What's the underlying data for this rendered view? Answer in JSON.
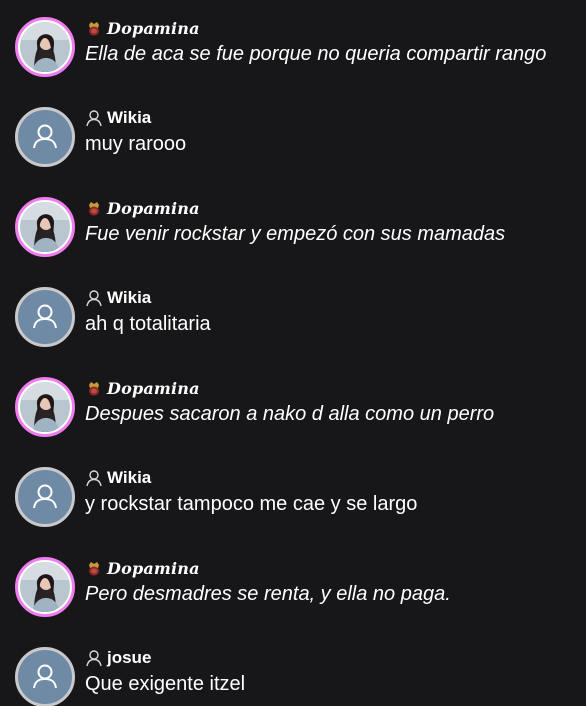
{
  "messages": [
    {
      "author": "Dopamina",
      "text": "Ella de aca se fue porque no queria compartir rango",
      "avatar": "photo-avatar",
      "role_icon": "crown-icon",
      "italic": true
    },
    {
      "author": "Wikia",
      "text": "muy rarooo",
      "avatar": "default-avatar",
      "role_icon": "user-outline-icon",
      "italic": false
    },
    {
      "author": "Dopamina",
      "text": "Fue venir rockstar y empezó con sus mamadas",
      "avatar": "photo-avatar",
      "role_icon": "crown-icon",
      "italic": true
    },
    {
      "author": "Wikia",
      "text": "ah q totalitaria",
      "avatar": "default-avatar",
      "role_icon": "user-outline-icon",
      "italic": false
    },
    {
      "author": "Dopamina",
      "text": "Despues sacaron a nako d alla como un perro",
      "avatar": "photo-avatar",
      "role_icon": "crown-icon",
      "italic": true
    },
    {
      "author": "Wikia",
      "text": "y rockstar tampoco me cae y se largo",
      "avatar": "default-avatar",
      "role_icon": "user-outline-icon",
      "italic": false
    },
    {
      "author": "Dopamina",
      "text": "Pero desmadres se renta, y ella no paga.",
      "avatar": "photo-avatar",
      "role_icon": "crown-icon",
      "italic": true
    },
    {
      "author": "josue",
      "text": "Que exigente itzel",
      "avatar": "default-avatar",
      "role_icon": "user-outline-icon",
      "italic": false
    }
  ],
  "colors": {
    "background": "#171719",
    "avatar_ring_pink": "#f07cf0",
    "avatar_default_bg": "#6f8aa5",
    "avatar_default_ring": "#c9c9cc",
    "text": "#ffffff"
  }
}
